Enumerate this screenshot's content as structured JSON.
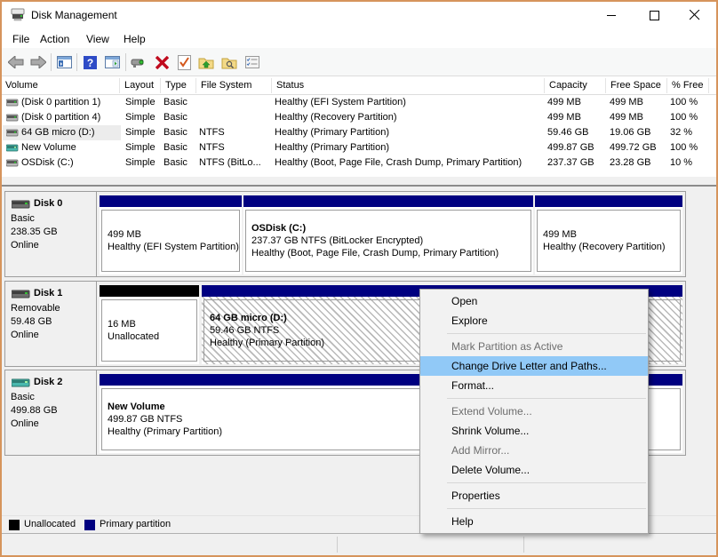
{
  "colors": {
    "window_border": "#d6945c",
    "primary_partition": "#000080",
    "unallocated": "#000000",
    "menu_highlight": "#91c9f7",
    "disabled_text": "#6d6d6d"
  },
  "window": {
    "title": "Disk Management",
    "controls": [
      "minimize",
      "maximize",
      "close"
    ]
  },
  "menu_bar": {
    "items": [
      "File",
      "Action",
      "View",
      "Help"
    ]
  },
  "toolbar": {
    "icons": [
      "back-arrow",
      "forward-arrow",
      "console-window",
      "help",
      "action-pane-window",
      "device",
      "delete-x",
      "document-check",
      "folder-up",
      "folder-search",
      "checklist"
    ]
  },
  "volume_table": {
    "columns": [
      "Volume",
      "Layout",
      "Type",
      "File System",
      "Status",
      "Capacity",
      "Free Space",
      "% Free"
    ],
    "rows": [
      {
        "cells": [
          "(Disk 0 partition 1)",
          "Simple",
          "Basic",
          "",
          "Healthy (EFI System Partition)",
          "499 MB",
          "499 MB",
          "100 %"
        ],
        "selected": false
      },
      {
        "cells": [
          "(Disk 0 partition 4)",
          "Simple",
          "Basic",
          "",
          "Healthy (Recovery Partition)",
          "499 MB",
          "499 MB",
          "100 %"
        ],
        "selected": false
      },
      {
        "cells": [
          "64 GB micro (D:)",
          "Simple",
          "Basic",
          "NTFS",
          "Healthy (Primary Partition)",
          "59.46 GB",
          "19.06 GB",
          "32 %"
        ],
        "selected": true
      },
      {
        "cells": [
          "New Volume",
          "Simple",
          "Basic",
          "NTFS",
          "Healthy (Primary Partition)",
          "499.87 GB",
          "499.72 GB",
          "100 %"
        ],
        "selected": false
      },
      {
        "cells": [
          "OSDisk (C:)",
          "Simple",
          "Basic",
          "NTFS (BitLo...",
          "Healthy (Boot, Page File, Crash Dump, Primary Partition)",
          "237.37 GB",
          "23.28 GB",
          "10 %"
        ],
        "selected": false
      }
    ]
  },
  "disks": [
    {
      "name": "Disk 0",
      "kind": "Basic",
      "size": "238.35 GB",
      "status": "Online",
      "partitions": [
        {
          "title": "",
          "lines": [
            "499 MB",
            "Healthy (EFI System Partition)"
          ],
          "fill": "primary"
        },
        {
          "title": "OSDisk  (C:)",
          "lines": [
            "237.37 GB NTFS (BitLocker Encrypted)",
            "Healthy (Boot, Page File, Crash Dump, Primary Partition)"
          ],
          "fill": "primary"
        },
        {
          "title": "",
          "lines": [
            "499 MB",
            "Healthy (Recovery Partition)"
          ],
          "fill": "primary"
        }
      ]
    },
    {
      "name": "Disk 1",
      "kind": "Removable",
      "size": "59.48 GB",
      "status": "Online",
      "partitions": [
        {
          "title": "",
          "lines": [
            "16 MB",
            "Unallocated"
          ],
          "fill": "unallocated"
        },
        {
          "title": "64 GB micro  (D:)",
          "lines": [
            "59.46 GB NTFS",
            "Healthy (Primary Partition)"
          ],
          "fill": "primary",
          "selected": true
        }
      ]
    },
    {
      "name": "Disk 2",
      "kind": "Basic",
      "size": "499.88 GB",
      "status": "Online",
      "partitions": [
        {
          "title": "New Volume",
          "lines": [
            "499.87 GB NTFS",
            "Healthy (Primary Partition)"
          ],
          "fill": "primary"
        }
      ]
    }
  ],
  "context_menu": {
    "items": [
      {
        "label": "Open",
        "state": "normal"
      },
      {
        "label": "Explore",
        "state": "normal"
      },
      {
        "type": "separator"
      },
      {
        "label": "Mark Partition as Active",
        "state": "disabled"
      },
      {
        "label": "Change Drive Letter and Paths...",
        "state": "highlighted"
      },
      {
        "label": "Format...",
        "state": "normal"
      },
      {
        "type": "separator"
      },
      {
        "label": "Extend Volume...",
        "state": "disabled"
      },
      {
        "label": "Shrink Volume...",
        "state": "normal"
      },
      {
        "label": "Add Mirror...",
        "state": "disabled"
      },
      {
        "label": "Delete Volume...",
        "state": "normal"
      },
      {
        "type": "separator"
      },
      {
        "label": "Properties",
        "state": "normal"
      },
      {
        "type": "separator"
      },
      {
        "label": "Help",
        "state": "normal"
      }
    ]
  },
  "legend": {
    "items": [
      {
        "label": "Unallocated",
        "color": "#000000"
      },
      {
        "label": "Primary partition",
        "color": "#000080"
      }
    ]
  }
}
